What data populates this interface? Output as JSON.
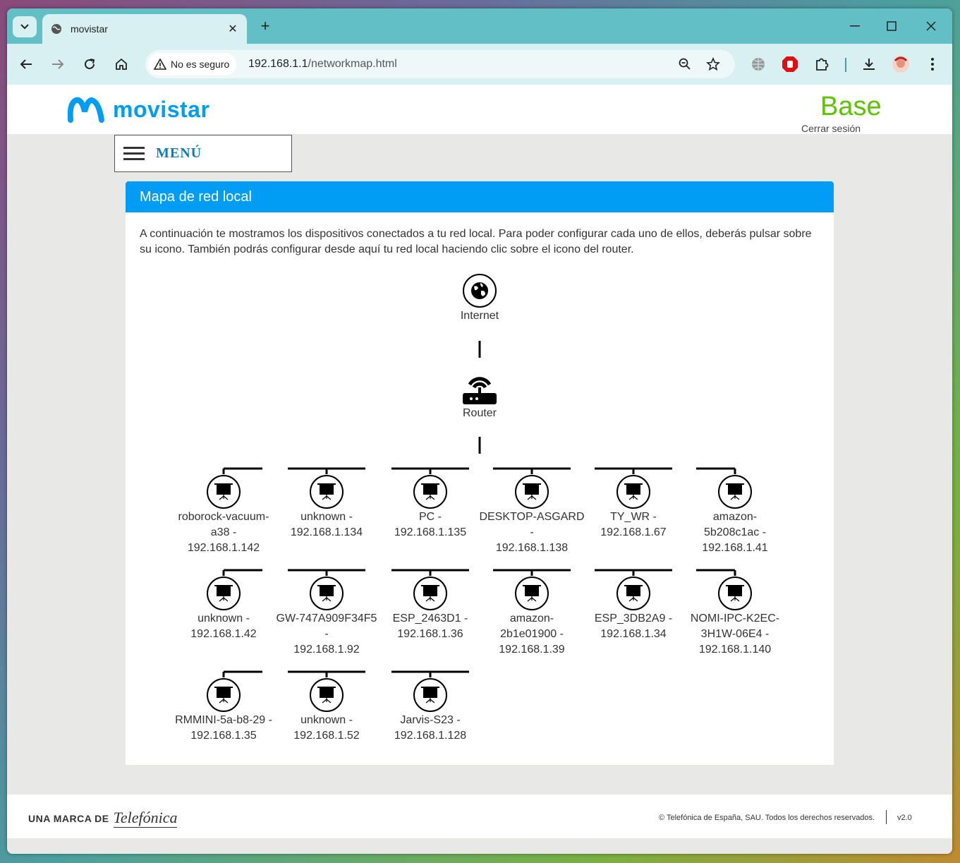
{
  "browser": {
    "tab_title": "movistar",
    "security_label": "No es seguro",
    "url_host": "192.168.1.1",
    "url_path": "/networkmap.html"
  },
  "header": {
    "brand": "movistar",
    "plan": "Base",
    "logout": "Cerrar sesión",
    "menu_label": "MENÚ"
  },
  "panel": {
    "title": "Mapa de red local",
    "intro": "A continuación te mostramos los dispositivos conectados a  tu red local. Para poder configurar cada uno de ellos, deberás pulsar sobre su icono. También podrás configurar desde aquí tu red local haciendo clic sobre el icono del router."
  },
  "network": {
    "internet_label": "Internet",
    "router_label": "Router",
    "devices": [
      {
        "lines": [
          "roborock-vacuum-",
          "a38 -",
          "192.168.1.142"
        ]
      },
      {
        "lines": [
          "unknown -",
          "192.168.1.134"
        ]
      },
      {
        "lines": [
          "PC -",
          "192.168.1.135"
        ]
      },
      {
        "lines": [
          "DESKTOP-ASGARD",
          "-",
          "192.168.1.138"
        ]
      },
      {
        "lines": [
          "TY_WR -",
          "192.168.1.67"
        ]
      },
      {
        "lines": [
          "amazon-",
          "5b208c1ac -",
          "192.168.1.41"
        ]
      },
      {
        "lines": [
          "unknown -",
          "192.168.1.42"
        ]
      },
      {
        "lines": [
          "GW-747A909F34F5",
          "-",
          "192.168.1.92"
        ]
      },
      {
        "lines": [
          "ESP_2463D1 -",
          "192.168.1.36"
        ]
      },
      {
        "lines": [
          "amazon-",
          "2b1e01900 -",
          "192.168.1.39"
        ]
      },
      {
        "lines": [
          "ESP_3DB2A9 -",
          "192.168.1.34"
        ]
      },
      {
        "lines": [
          "NOMI-IPC-K2EC-",
          "3H1W-06E4 -",
          "192.168.1.140"
        ]
      },
      {
        "lines": [
          "RMMINI-5a-b8-29 -",
          "192.168.1.35"
        ]
      },
      {
        "lines": [
          "unknown -",
          "192.168.1.52"
        ]
      },
      {
        "lines": [
          "Jarvis-S23 -",
          "192.168.1.128"
        ]
      }
    ]
  },
  "footer": {
    "brand_prefix": "UNA MARCA DE",
    "brand_name": "Telefónica",
    "copyright": "© Telefónica de España, SAU. Todos los derechos reservados.",
    "version": "v2.0"
  }
}
